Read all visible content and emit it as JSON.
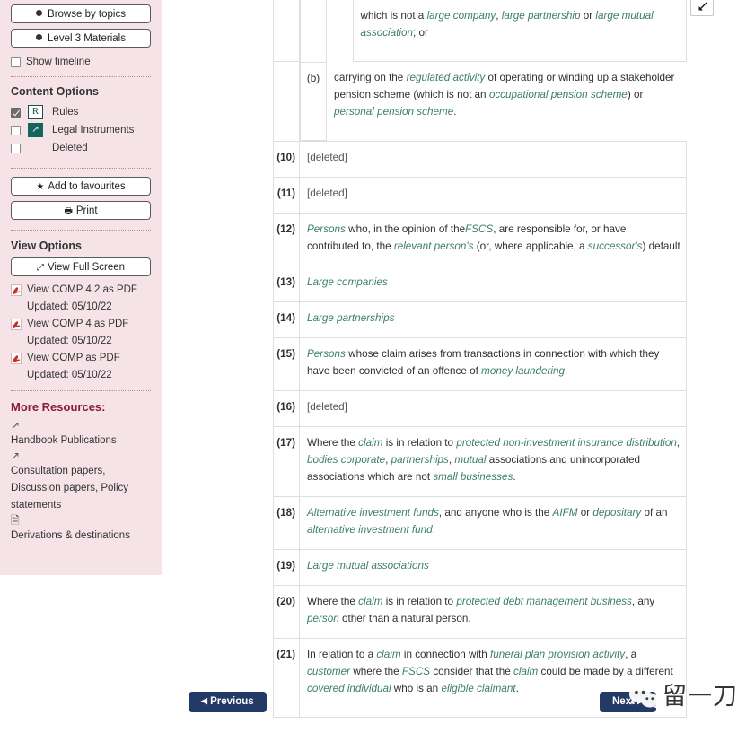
{
  "sidebar": {
    "browse_button": "Browse by topics",
    "level_button": "Level 3 Materials",
    "show_timeline": "Show timeline",
    "content_options_title": "Content Options",
    "options": [
      {
        "label": "Rules",
        "badge": "R",
        "checked": true
      },
      {
        "label": "Legal Instruments",
        "badge": "↗",
        "checked": false
      },
      {
        "label": "Deleted",
        "badge": "",
        "checked": false
      }
    ],
    "favourites_button": "Add to favourites",
    "print_button": "Print",
    "view_options_title": "View Options",
    "fullscreen_button": "View Full Screen",
    "pdf_links": [
      {
        "label": "View COMP 4.2 as PDF",
        "updated": "Updated: 05/10/22"
      },
      {
        "label": "View COMP 4 as PDF",
        "updated": "Updated: 05/10/22"
      },
      {
        "label": "View COMP as PDF",
        "updated": "Updated: 05/10/22"
      }
    ],
    "more_resources_title": "More Resources:",
    "resources": [
      {
        "icon": "external-link-icon",
        "label": "Handbook Publications"
      },
      {
        "icon": "external-link-icon",
        "label": "Consultation papers, Discussion papers, Policy statements"
      },
      {
        "icon": "document-icon",
        "label": "Derivations & destinations"
      }
    ]
  },
  "main": {
    "expand_icon": "expand-collapse-icon",
    "rows": [
      {
        "id": "row-continuation",
        "number": "",
        "sub_label": "",
        "html": "which is not a <i class=\"gl\">large company</i>, <i class=\"gl\">large partnership</i> or <i class=\"gl\">large mutual association</i>; or"
      },
      {
        "id": "row-b",
        "number": "",
        "sub_label": "(b)",
        "html": "carrying on the <i class=\"gl\">regulated activity</i> of operating or winding up a stakeholder pension scheme (which is not an <i class=\"gl\">occupational pension scheme</i>) or <i class=\"gl\">personal pension scheme</i>."
      },
      {
        "id": "row-10",
        "number": "(10)",
        "html": "<span class=\"deleted\">[deleted]</span>"
      },
      {
        "id": "row-11",
        "number": "(11)",
        "html": "<span class=\"deleted\">[deleted]</span>"
      },
      {
        "id": "row-12",
        "number": "(12)",
        "html": "<i class=\"gl\">Persons</i> who, in the opinion of the<i class=\"gl\">FSCS</i>, are responsible for, or have contributed to, the <i class=\"gl\">relevant person's</i> (or, where applicable, a <i class=\"gl\">successor's</i>) default"
      },
      {
        "id": "row-13",
        "number": "(13)",
        "html": "<i class=\"gl\">Large companies</i>"
      },
      {
        "id": "row-14",
        "number": "(14)",
        "html": "<i class=\"gl\">Large partnerships</i>"
      },
      {
        "id": "row-15",
        "number": "(15)",
        "html": "<i class=\"gl\">Persons</i> whose claim arises from transactions in connection with which they have been convicted of an offence of <i class=\"gl\">money laundering</i>."
      },
      {
        "id": "row-16",
        "number": "(16)",
        "html": "<span class=\"deleted\">[deleted]</span>"
      },
      {
        "id": "row-17",
        "number": "(17)",
        "html": "Where the <i class=\"gl\">claim</i> is in relation to <i class=\"gl\">protected non-investment insurance distribution</i>, <i class=\"gl\">bodies corporate</i>, <i class=\"gl\">partnerships</i>, <i class=\"gl\">mutual</i> associations and unincorporated associations which are not <i class=\"gl\">small businesses</i>."
      },
      {
        "id": "row-18",
        "number": "(18)",
        "html": "<i class=\"gl\">Alternative investment funds</i>, and anyone who is the <i class=\"gl\">AIFM</i> or <i class=\"gl\">depositary</i> of an <i class=\"gl\">alternative investment fund</i>."
      },
      {
        "id": "row-19",
        "number": "(19)",
        "html": "<i class=\"gl\">Large mutual associations</i>"
      },
      {
        "id": "row-20",
        "number": "(20)",
        "html": "Where the <i class=\"gl\">claim</i> is in relation to <i class=\"gl\">protected debt management business</i>, any <i class=\"gl\">person</i> other than a natural person."
      },
      {
        "id": "row-21",
        "number": "(21)",
        "html": "In relation to a <i class=\"gl\">claim</i> in connection with <i class=\"gl\">funeral plan provision activity</i>, a <i class=\"gl\">customer</i> where the <i class=\"gl\">FSCS</i> consider that the <i class=\"gl\">claim</i> could be made by a different <i class=\"gl\">covered individual</i> who is an <i class=\"gl\">eligible claimant</i>."
      }
    ]
  },
  "footer": {
    "previous_label": "Previous",
    "next_label": "Next"
  },
  "watermark": {
    "text": "留一刀",
    "logo": "wechat-logo"
  },
  "colors": {
    "sidebar_bg": "#f5e3e8",
    "glossary_link": "#3b7d6f",
    "nav_button": "#243a66",
    "more_resources_heading": "#8b1a3d",
    "badge_teal": "#12665c"
  }
}
